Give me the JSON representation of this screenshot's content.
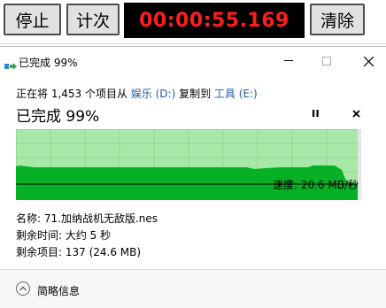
{
  "stopwatch": {
    "start_label": "停止",
    "lap_label": "计次",
    "time": "00:00:55.169",
    "clear_label": "清除",
    "time_color": "#ff1e1e"
  },
  "dialog": {
    "title": "已完成 99%",
    "summary": {
      "prefix": "正在将 1,453 个项目从 ",
      "source": "娱乐 (D:)",
      "middle": " 复制到 ",
      "destination": "工具 (E:)"
    },
    "status": "已完成 99%",
    "progress_percent": 99,
    "speed": "速度: 20.6 MB/秒",
    "name_line": "名称: 71.加纳战机无敌版.nes",
    "time_left_line": "剩余时间: 大约 5 秒",
    "items_left_line": "剩余项目: 137 (24.6 MB)",
    "details_toggle": "简略信息",
    "colors": {
      "graph_fill": "#06b025",
      "graph_bg": "#a8e8a8",
      "link": "#1e5aa8"
    },
    "icons": {
      "title": "copy-files-icon",
      "pause": "pause-icon",
      "stop": "stop-icon",
      "minimize": "minimize-icon",
      "maximize": "maximize-icon",
      "close": "close-icon",
      "collapse": "chevron-up-icon"
    }
  }
}
